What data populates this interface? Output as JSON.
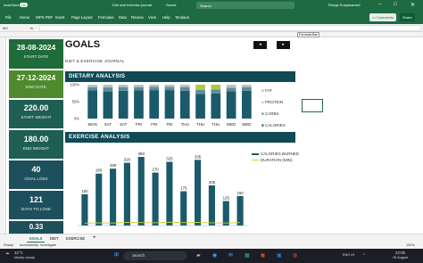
{
  "window": {
    "autosave_label": "AutoSave",
    "autosave_state": "On",
    "filename": "Diet and exercise journal",
    "saved_label": "Saved",
    "search": "Search",
    "user": "Rutuja Suryawanshi"
  },
  "ribbon": {
    "tabs": [
      "File",
      "Home",
      "WPS PDF",
      "Insert",
      "Page Layout",
      "Formulas",
      "Data",
      "Review",
      "View",
      "Help",
      "Tendaus"
    ],
    "comments_label": "Comments",
    "share_label": "Share"
  },
  "formula_bar": {
    "name_box": "M9",
    "fx": "fx"
  },
  "cards": [
    {
      "value": "28-08-2024",
      "label": "START DATE",
      "color": "#1f6b3a"
    },
    {
      "value": "27-12-2024",
      "label": "END DATE",
      "color": "#4f8a2e"
    },
    {
      "value": "220.00",
      "label": "START WEIGHT",
      "color": "#1f5e52"
    },
    {
      "value": "180.00",
      "label": "END WEIGHT",
      "color": "#1f5e52"
    },
    {
      "value": "40",
      "label": "GOAL LOSS",
      "color": "#1d4f5c"
    },
    {
      "value": "121",
      "label": "DAYS TO LOSE",
      "color": "#1d4f5c"
    },
    {
      "value": "0.33",
      "label": "",
      "color": "#1d4f5c"
    }
  ],
  "main": {
    "title": "GOALS",
    "prev_label": "◂",
    "next_label": "▸",
    "subtitle": "DIET & EXERCISE JOURNAL",
    "tooltip": "Formula Bar"
  },
  "colors": {
    "excel_green": "#1e6b43",
    "dark_teal": "#0f4a55",
    "calories_bar": "#1b5a6b",
    "duration_line": "#c4d13a",
    "fat": "#a9c94f",
    "protein": "#b7c2c6",
    "carbs": "#5f8d96"
  },
  "chart_data": [
    {
      "type": "bar",
      "title": "DIETARY ANALYSIS",
      "stacked": true,
      "percent": true,
      "ylim": [
        0,
        100
      ],
      "yticks": [
        "100%",
        "50%",
        "0%"
      ],
      "categories": [
        "MON",
        "SAT",
        "SAT",
        "FRI",
        "FRI",
        "FRI",
        "THU",
        "THU",
        "THU",
        "WED",
        "WED"
      ],
      "series": [
        {
          "name": "FAT",
          "color": "#a9c94f",
          "values": [
            0,
            0,
            0,
            0,
            0,
            0,
            0,
            15,
            14,
            0,
            0
          ]
        },
        {
          "name": "PROTEIN",
          "color": "#b7c2c6",
          "values": [
            7,
            8,
            7,
            7,
            6,
            6,
            7,
            0,
            0,
            9,
            7
          ]
        },
        {
          "name": "CARBS",
          "color": "#5f8d96",
          "values": [
            10,
            12,
            11,
            10,
            10,
            10,
            11,
            12,
            12,
            10,
            11
          ]
        },
        {
          "name": "CALORIES",
          "color": "#1b5a6b",
          "values": [
            83,
            80,
            82,
            83,
            84,
            84,
            82,
            73,
            74,
            81,
            82
          ]
        }
      ],
      "legend": "right"
    },
    {
      "type": "bar",
      "title": "EXERCISE ANALYSIS",
      "categories": [
        "",
        "",
        "",
        "",
        "",
        "",
        "",
        "",
        "",
        "",
        "",
        ""
      ],
      "series": [
        {
          "name": "CALORIES BURNED",
          "color": "#1b5a6b",
          "values": [
            160,
            265,
            290,
            320,
            350,
            270,
            325,
            175,
            335,
            205,
            125,
            150
          ]
        },
        {
          "name": "DURATION (MIN)",
          "color": "#c4d13a",
          "type": "line",
          "values": [
            12,
            14,
            13,
            16,
            15,
            14,
            17,
            15,
            16,
            14,
            13,
            15
          ]
        }
      ],
      "ylim": [
        0,
        400
      ],
      "legend": "right"
    }
  ],
  "sheets": {
    "tabs": [
      "GOALS",
      "DIET",
      "EXERCISE"
    ],
    "add_label": "+"
  },
  "status": {
    "ready": "Ready",
    "accessibility": "Accessibility: Investigate",
    "zoom": "100%"
  },
  "taskbar": {
    "weather_temp": "22°C",
    "weather_text": "Mostly cloudy",
    "search": "Search",
    "lang": "ENG IN",
    "time": "22:05",
    "date": "28 August"
  }
}
